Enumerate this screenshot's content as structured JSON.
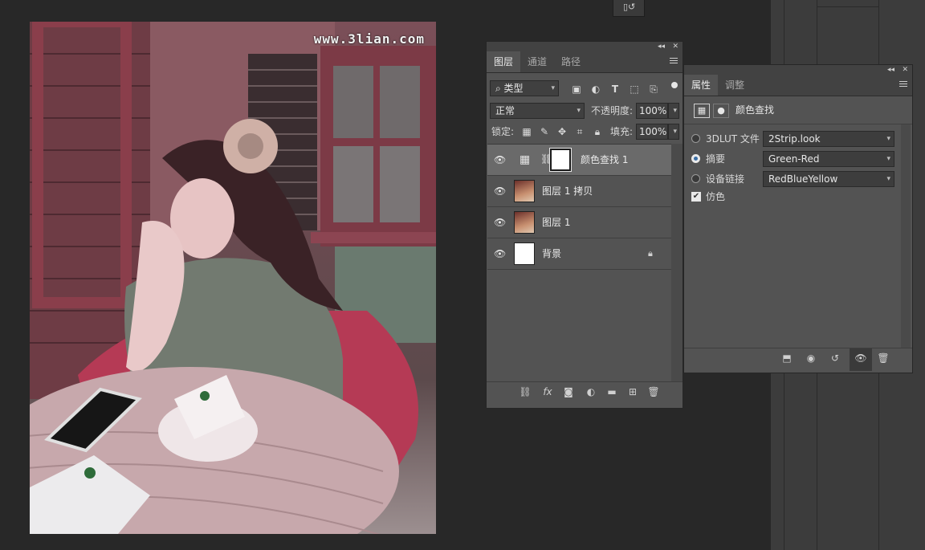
{
  "canvas": {
    "watermark": "www.3lian.com"
  },
  "layers_panel": {
    "tabs": [
      "图层",
      "通道",
      "路径"
    ],
    "filter_kind": "类型",
    "blend_mode": "正常",
    "opacity_label": "不透明度:",
    "opacity_value": "100%",
    "lock_label": "锁定:",
    "fill_label": "填充:",
    "fill_value": "100%",
    "layers": [
      {
        "name": "颜色查找 1",
        "selected": true
      },
      {
        "name": "图层 1 拷贝",
        "selected": false
      },
      {
        "name": "图层 1",
        "selected": false
      },
      {
        "name": "背景",
        "selected": false,
        "locked": true
      }
    ]
  },
  "properties_panel": {
    "tabs": [
      "属性",
      "调整"
    ],
    "adjustment_title": "颜色查找",
    "options": [
      {
        "label": "3DLUT 文件",
        "value": "2Strip.look",
        "selected": false
      },
      {
        "label": "摘要",
        "value": "Green-Red",
        "selected": true
      },
      {
        "label": "设备链接",
        "value": "RedBlueYellow",
        "selected": false
      }
    ],
    "dither_label": "仿色",
    "dither_checked": true
  },
  "colors": {
    "panel": "#535353",
    "panel_header": "#424242",
    "background": "#282828",
    "selected_layer": "#6a6a6a"
  }
}
